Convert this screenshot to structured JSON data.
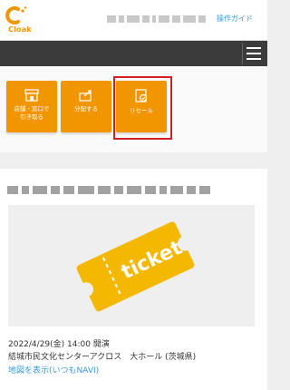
{
  "brand": {
    "logo_text": "Cloak",
    "accent": "#f29600"
  },
  "header": {
    "guide_link": "操作ガイド"
  },
  "nav": {
    "menu_icon": "hamburger-icon"
  },
  "actions": [
    {
      "label_line1": "店舗・窓口で",
      "label_line2": "引き取る",
      "icon": "store-icon"
    },
    {
      "label_line1": "分配する",
      "label_line2": "",
      "icon": "share-icon"
    },
    {
      "label_line1": "リセール",
      "label_line2": "",
      "icon": "resale-ticket-icon"
    }
  ],
  "event": {
    "ticket_text": "ticket",
    "date": "2022/4/29(金) 14:00 開演",
    "venue": "結城市民文化センターアクロス　大ホール (茨城県)",
    "map_link": "地図を表示(いつもNAVI)"
  },
  "colors": {
    "highlight": "#d32027",
    "link": "#3a9bd9",
    "navbar": "#3b3b3b"
  }
}
